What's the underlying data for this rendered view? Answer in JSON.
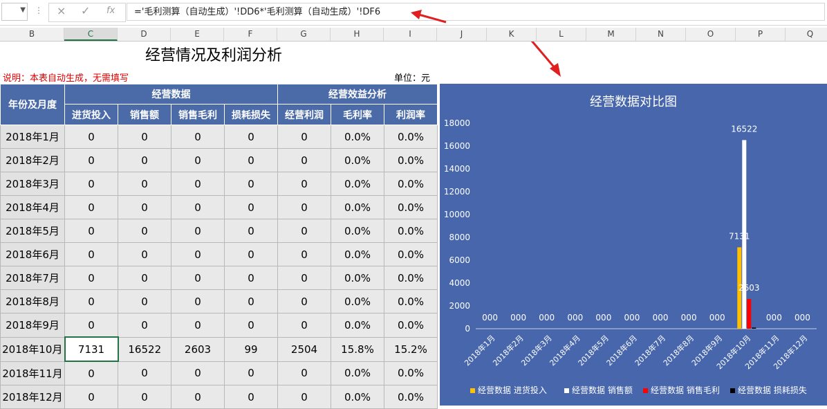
{
  "formula_bar": {
    "cancel_icon": "×",
    "enter_icon": "✓",
    "fx_label": "fx",
    "formula": "='毛利测算（自动生成）'!DD6*'毛利测算（自动生成）'!DF6"
  },
  "columns": [
    "B",
    "C",
    "D",
    "E",
    "F",
    "G",
    "H",
    "I",
    "J",
    "K",
    "L",
    "M",
    "N",
    "O",
    "P",
    "Q"
  ],
  "sheet": {
    "title": "经营情况及利润分析",
    "note": "说明：本表自动生成，无需填写",
    "unit": "单位：元",
    "header_month": "年份及月度",
    "group_ops": "经营数据",
    "group_eff": "经营效益分析",
    "sub_headers": [
      "进货投入",
      "销售额",
      "销售毛利",
      "损耗损失",
      "经营利润",
      "毛利率",
      "利润率"
    ],
    "rows": [
      [
        "2018年1月",
        "0",
        "0",
        "0",
        "0",
        "0",
        "0.0%",
        "0.0%"
      ],
      [
        "2018年2月",
        "0",
        "0",
        "0",
        "0",
        "0",
        "0.0%",
        "0.0%"
      ],
      [
        "2018年3月",
        "0",
        "0",
        "0",
        "0",
        "0",
        "0.0%",
        "0.0%"
      ],
      [
        "2018年4月",
        "0",
        "0",
        "0",
        "0",
        "0",
        "0.0%",
        "0.0%"
      ],
      [
        "2018年5月",
        "0",
        "0",
        "0",
        "0",
        "0",
        "0.0%",
        "0.0%"
      ],
      [
        "2018年6月",
        "0",
        "0",
        "0",
        "0",
        "0",
        "0.0%",
        "0.0%"
      ],
      [
        "2018年7月",
        "0",
        "0",
        "0",
        "0",
        "0",
        "0.0%",
        "0.0%"
      ],
      [
        "2018年8月",
        "0",
        "0",
        "0",
        "0",
        "0",
        "0.0%",
        "0.0%"
      ],
      [
        "2018年9月",
        "0",
        "0",
        "0",
        "0",
        "0",
        "0.0%",
        "0.0%"
      ],
      [
        "2018年10月",
        "7131",
        "16522",
        "2603",
        "99",
        "2504",
        "15.8%",
        "15.2%"
      ],
      [
        "2018年11月",
        "0",
        "0",
        "0",
        "0",
        "0",
        "0.0%",
        "0.0%"
      ],
      [
        "2018年12月",
        "0",
        "0",
        "0",
        "0",
        "0",
        "0.0%",
        "0.0%"
      ]
    ]
  },
  "chart_data": {
    "type": "bar",
    "title": "经营数据对比图",
    "categories": [
      "2018年1月",
      "2018年2月",
      "2018年3月",
      "2018年4月",
      "2018年5月",
      "2018年6月",
      "2018年7月",
      "2018年8月",
      "2018年9月",
      "2018年10月",
      "2018年11月",
      "2018年12月"
    ],
    "ylim": [
      0,
      18000
    ],
    "yticks": [
      "0",
      "2000",
      "4000",
      "6000",
      "8000",
      "10000",
      "12000",
      "14000",
      "16000",
      "18000"
    ],
    "grid": false,
    "legend_position": "bottom",
    "zero_label": "000",
    "series": [
      {
        "name": "经营数据 进货投入",
        "color": "#ffc000",
        "values": [
          0,
          0,
          0,
          0,
          0,
          0,
          0,
          0,
          0,
          7131,
          0,
          0
        ],
        "label": "7131"
      },
      {
        "name": "经营数据 销售额",
        "color": "#ffffff",
        "values": [
          0,
          0,
          0,
          0,
          0,
          0,
          0,
          0,
          0,
          16522,
          0,
          0
        ],
        "label": "16522"
      },
      {
        "name": "经营数据 销售毛利",
        "color": "#ff0000",
        "values": [
          0,
          0,
          0,
          0,
          0,
          0,
          0,
          0,
          0,
          2603,
          0,
          0
        ],
        "label": "2603"
      },
      {
        "name": "经营数据 损耗损失",
        "color": "#000000",
        "values": [
          0,
          0,
          0,
          0,
          0,
          0,
          0,
          0,
          0,
          99,
          0,
          0
        ],
        "label": ""
      }
    ]
  }
}
